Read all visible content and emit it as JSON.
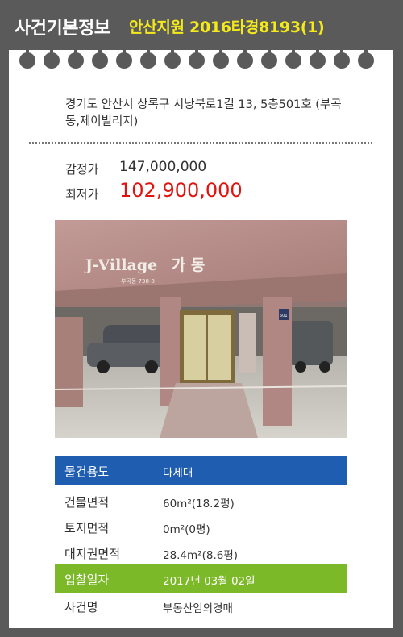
{
  "header": {
    "title": "사건기본정보",
    "case": "안산지원 2016타경8193(1)"
  },
  "address": "경기도 안산시 상록구 시낭북로1길 13, 5층501호 (부곡동,제이빌리지)",
  "prices": {
    "appraisal_label": "감정가",
    "appraisal_value": "147,000,000",
    "minimum_label": "최저가",
    "minimum_value": "102,900,000"
  },
  "photo": {
    "sign": "J-Villageㅤ가 동",
    "sign_sub": "부곡동 738-8",
    "door_number": "501"
  },
  "details": [
    {
      "label": "물건용도",
      "value": "다세대"
    },
    {
      "label": "건물면적",
      "value": "60m²(18.2평)"
    },
    {
      "label": "토지면적",
      "value": "0m²(0평)"
    },
    {
      "label": "대지권면적",
      "value": "28.4m²(8.6평)"
    },
    {
      "label": "입찰일자",
      "value": "2017년 03월 02일"
    },
    {
      "label": "사건명",
      "value": "부동산임의경매"
    }
  ],
  "colors": {
    "background": "#5a5a5a",
    "case_text": "#f4e91a",
    "minimum_price": "#e0140e",
    "usage_row": "#1e5db0",
    "bid_date_row": "#7cb928"
  }
}
